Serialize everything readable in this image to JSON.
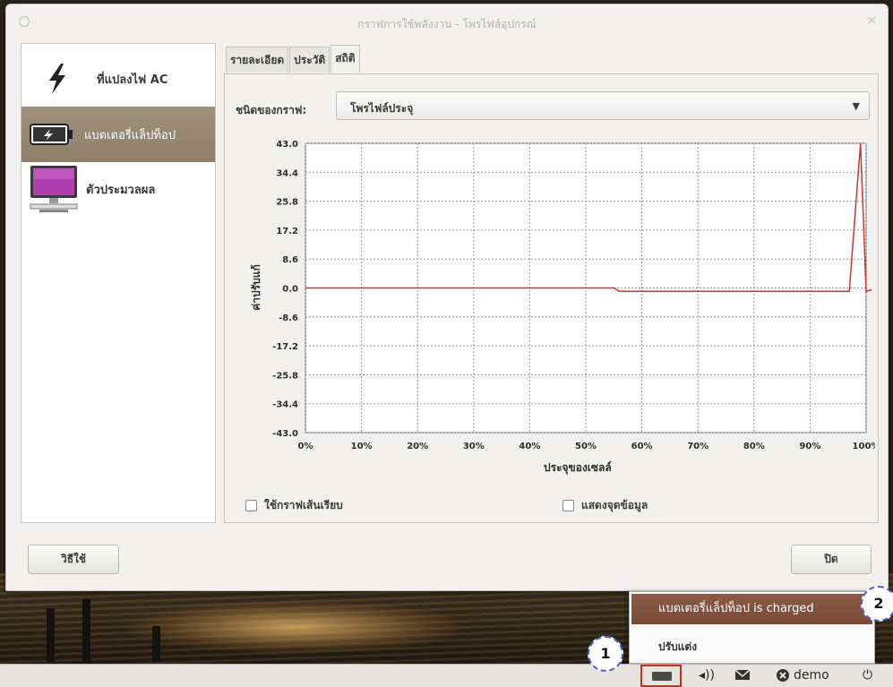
{
  "window": {
    "title": "กราฟการใช้พลังงาน - โพรไฟล์อุปกรณ์",
    "close_glyph": "×"
  },
  "devices": [
    {
      "label": "ที่แปลงไฟ AC",
      "icon": "lightning-icon"
    },
    {
      "label": "แบตเตอรี่แล็ปท็อป",
      "icon": "battery-icon",
      "selected": true
    },
    {
      "label": "ตัวประมวลผล",
      "icon": "computer-monitor-icon"
    }
  ],
  "tabs": [
    "รายละเอียด",
    "ประวัติ",
    "สถิติ"
  ],
  "active_tab": "สถิติ",
  "graph_type": {
    "label": "ชนิดของกราฟ:",
    "value": "โพรไฟล์ประจุ",
    "arrow": "▼"
  },
  "chart_data": {
    "type": "line",
    "xlabel": "ประจุของเซลล์",
    "ylabel": "ค่าปรับแก้",
    "x_ticks": [
      "0%",
      "10%",
      "20%",
      "30%",
      "40%",
      "50%",
      "60%",
      "70%",
      "80%",
      "90%",
      "100%"
    ],
    "y_ticks": [
      "43.0",
      "34.4",
      "25.8",
      "17.2",
      "8.6",
      "0.0",
      "-8.6",
      "-17.2",
      "-25.8",
      "-34.4",
      "-43.0"
    ],
    "xlim": [
      0,
      100
    ],
    "ylim": [
      -43.0,
      43.0
    ],
    "grid": true,
    "series": [
      {
        "color": "#d9302c",
        "points": [
          [
            0,
            0.0
          ],
          [
            55,
            0.0
          ],
          [
            56,
            -1.0
          ],
          [
            97,
            -1.0
          ],
          [
            99,
            43.0
          ],
          [
            100,
            -1.0
          ],
          [
            101,
            -0.5
          ]
        ]
      }
    ]
  },
  "options": {
    "smooth": "ใช้กราฟเส้นเรียบ",
    "datapoints": "แสดงจุดข้อมูล"
  },
  "buttons": {
    "help": "วิธีใช้",
    "close": "ปิด"
  },
  "popup": {
    "highlighted": "แบตเตอรี่แล็ปท็อป is charged",
    "item2": "ปรับแต่ง"
  },
  "panel": {
    "volume": "◂))",
    "user": "demo",
    "power": "⏻"
  },
  "callouts": [
    "1",
    "2"
  ]
}
